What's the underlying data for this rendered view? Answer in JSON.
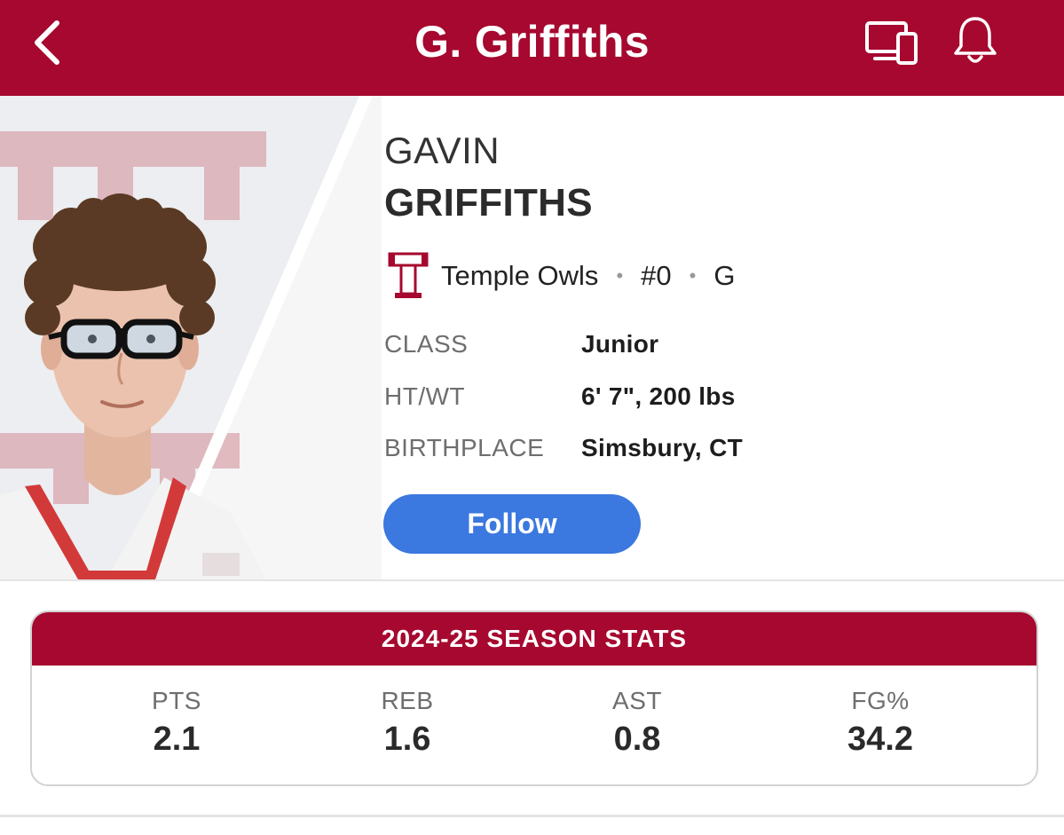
{
  "header": {
    "title": "G. Griffiths",
    "back_icon": "chevron-left-icon",
    "devices_icon": "devices-icon",
    "bell_icon": "bell-icon",
    "bar_color": "#a6082f"
  },
  "player": {
    "first_name": "GAVIN",
    "last_name": "GRIFFITHS",
    "team": "Temple Owls",
    "number": "#0",
    "position": "G",
    "separator": "•",
    "team_logo_letter": "T",
    "team_color": "#a6082f"
  },
  "info": [
    {
      "label": "CLASS",
      "value": "Junior"
    },
    {
      "label": "HT/WT",
      "value": "6' 7\", 200 lbs"
    },
    {
      "label": "BIRTHPLACE",
      "value": "Simsbury, CT"
    }
  ],
  "follow": {
    "label": "Follow",
    "color": "#3b78df"
  },
  "stats": {
    "title": "2024-25 SEASON STATS",
    "items": [
      {
        "label": "PTS",
        "value": "2.1"
      },
      {
        "label": "REB",
        "value": "1.6"
      },
      {
        "label": "AST",
        "value": "0.8"
      },
      {
        "label": "FG%",
        "value": "34.2"
      }
    ]
  }
}
